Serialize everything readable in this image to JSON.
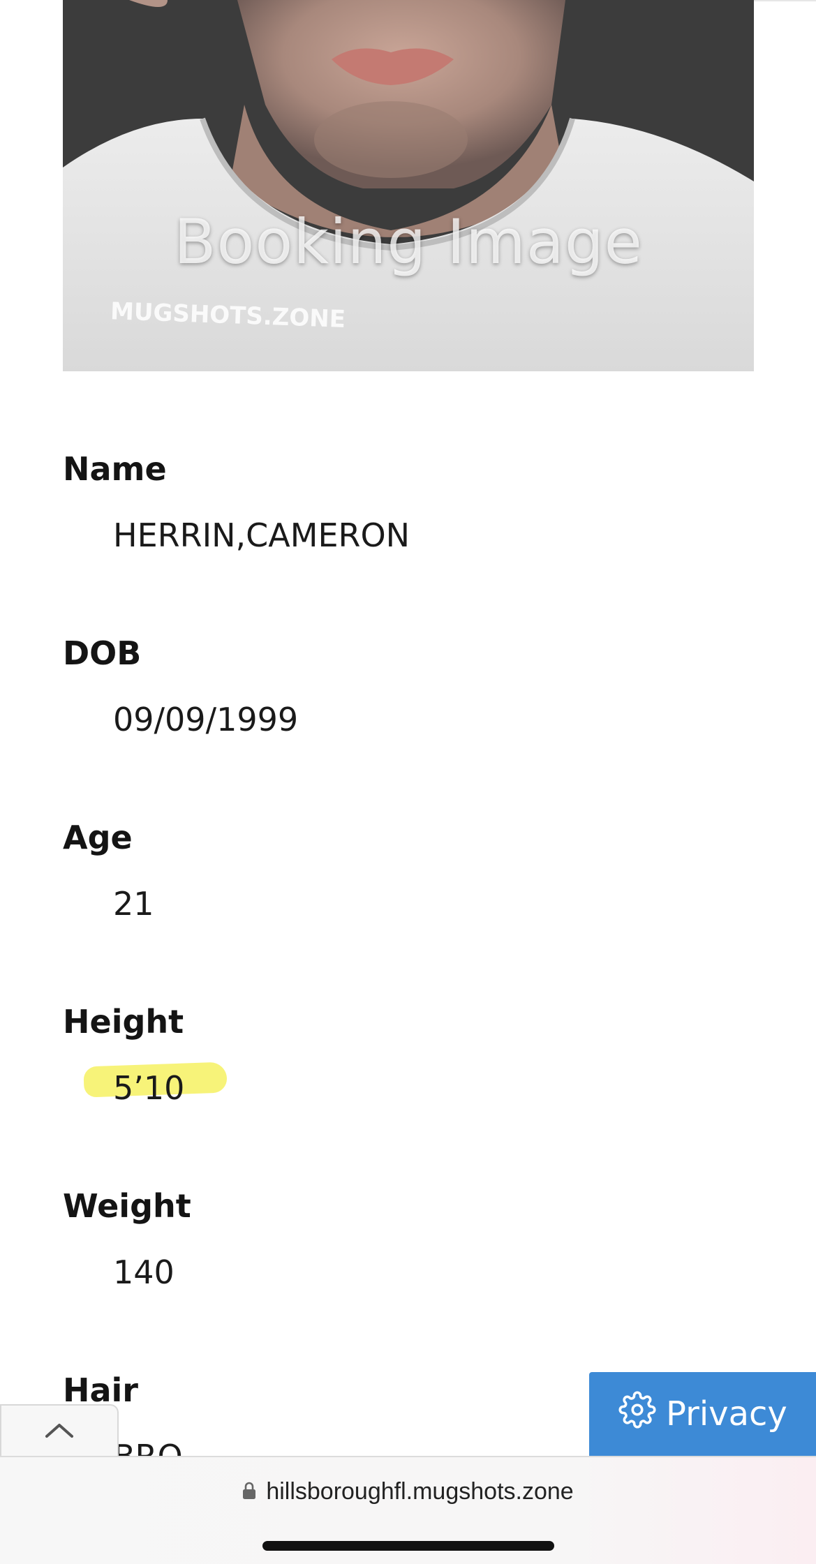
{
  "booking_image": {
    "watermark_main": "Booking Image",
    "watermark_small": "MUGSHOTS.ZONE"
  },
  "fields": {
    "name": {
      "label": "Name",
      "value": "HERRIN,CAMERON"
    },
    "dob": {
      "label": "DOB",
      "value": "09/09/1999"
    },
    "age": {
      "label": "Age",
      "value": "21"
    },
    "height": {
      "label": "Height",
      "value": "5’10",
      "highlighted": true,
      "highlight_color": "#f6f26a"
    },
    "weight": {
      "label": "Weight",
      "value": "140"
    },
    "hair": {
      "label": "Hair",
      "value": "BRO"
    }
  },
  "privacy_button": {
    "label": "Privacy",
    "icon": "gear-icon",
    "color": "#3d8ad6"
  },
  "scroll_top": {
    "icon": "chevron-up-icon"
  },
  "address_bar": {
    "url": "hillsboroughfl.mugshots.zone",
    "icon": "lock-icon"
  }
}
